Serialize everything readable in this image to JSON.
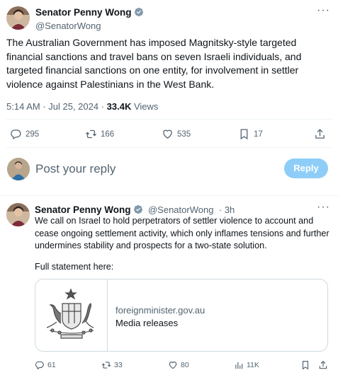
{
  "main_tweet": {
    "author_name": "Senator Penny Wong",
    "author_handle": "@SenatorWong",
    "text": "The Australian Government has imposed Magnitsky-style targeted financial sanctions and travel bans on seven Israeli individuals, and targeted financial sanctions on one entity, for involvement in settler violence against Palestinians in the West Bank.",
    "time": "5:14 AM · Jul 25, 2024 · ",
    "views_count": "33.4K",
    "views_label": " Views",
    "more_label": "···",
    "actions": {
      "replies": "295",
      "retweets": "166",
      "likes": "535",
      "bookmarks": "17"
    }
  },
  "reply_box": {
    "placeholder": "Post your reply",
    "button_label": "Reply"
  },
  "reply_tweet": {
    "author_name": "Senator Penny Wong",
    "author_handle": "@SenatorWong",
    "time": "· 3h",
    "more_label": "···",
    "text": "We call on Israel to hold perpetrators of settler violence to account and cease ongoing settlement activity, which only inflames tensions and further undermines stability and prospects for a two-state solution.",
    "statement_label": "Full statement here:",
    "card": {
      "domain": "foreignminister.gov.au",
      "title": "Media releases"
    },
    "actions": {
      "replies": "61",
      "retweets": "33",
      "likes": "80",
      "views": "11K"
    }
  },
  "colors": {
    "verified_badge": "#829aab",
    "reply_button": "#8ecdf8",
    "text_primary": "#0f1419",
    "text_secondary": "#536471"
  }
}
